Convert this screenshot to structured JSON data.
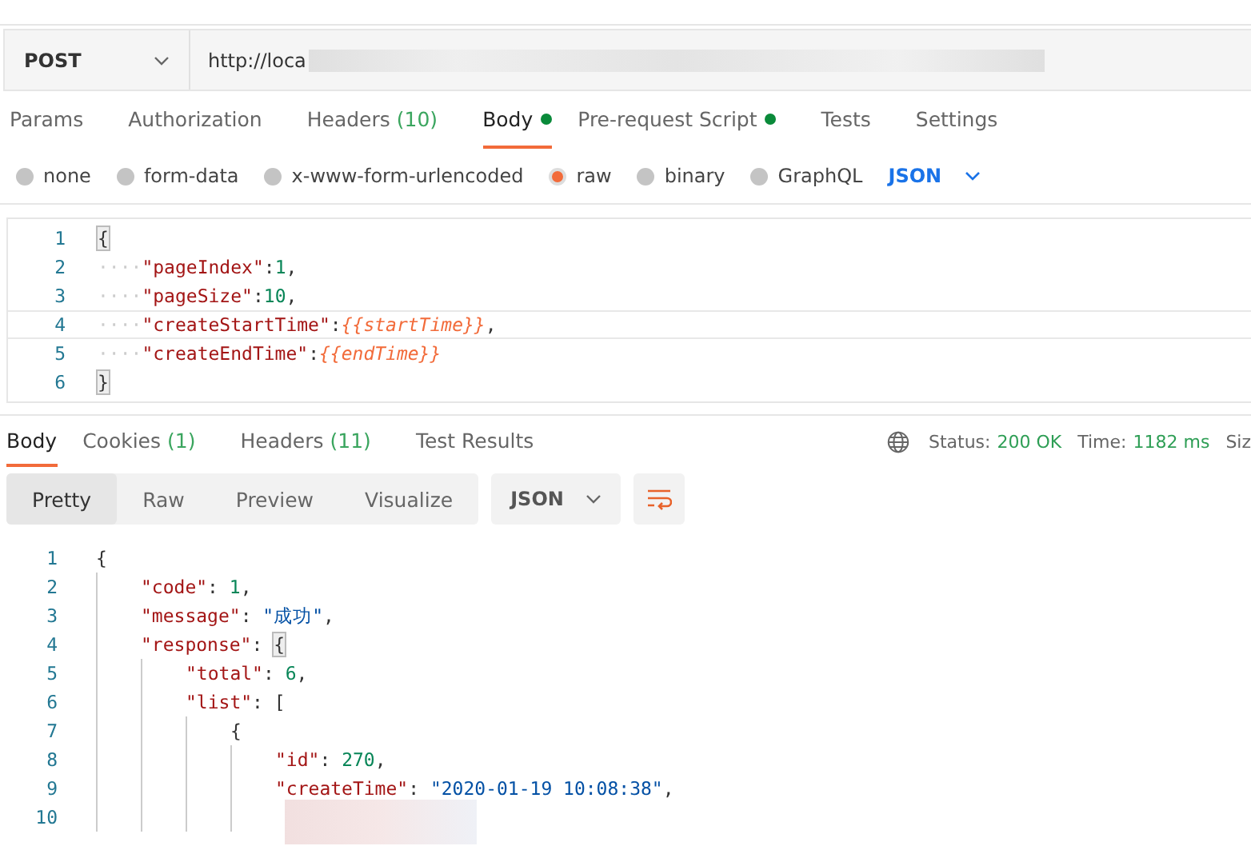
{
  "request": {
    "method": "POST",
    "url": "http://loca"
  },
  "request_tabs": [
    {
      "label": "Params",
      "selected": false
    },
    {
      "label": "Authorization",
      "selected": false
    },
    {
      "label": "Headers",
      "count": "(10)",
      "selected": false
    },
    {
      "label": "Body",
      "dot": true,
      "selected": true
    },
    {
      "label": "Pre-request Script",
      "dot": true,
      "selected": false
    },
    {
      "label": "Tests",
      "selected": false
    },
    {
      "label": "Settings",
      "selected": false
    }
  ],
  "body_types": [
    {
      "label": "none",
      "selected": false
    },
    {
      "label": "form-data",
      "selected": false
    },
    {
      "label": "x-www-form-urlencoded",
      "selected": false
    },
    {
      "label": "raw",
      "selected": true
    },
    {
      "label": "binary",
      "selected": false
    },
    {
      "label": "GraphQL",
      "selected": false
    }
  ],
  "body_format": "JSON",
  "request_body": [
    {
      "number": "1",
      "current": false,
      "tokens": [
        {
          "kind": "match",
          "text": "{"
        }
      ]
    },
    {
      "number": "2",
      "current": false,
      "tokens": [
        {
          "kind": "ws",
          "text": "····"
        },
        {
          "kind": "key",
          "text": "\"pageIndex\""
        },
        {
          "kind": "punct",
          "text": ":"
        },
        {
          "kind": "num",
          "text": "1"
        },
        {
          "kind": "punct",
          "text": ","
        }
      ]
    },
    {
      "number": "3",
      "current": false,
      "tokens": [
        {
          "kind": "ws",
          "text": "····"
        },
        {
          "kind": "key",
          "text": "\"pageSize\""
        },
        {
          "kind": "punct",
          "text": ":"
        },
        {
          "kind": "num",
          "text": "10"
        },
        {
          "kind": "punct",
          "text": ","
        }
      ]
    },
    {
      "number": "4",
      "current": true,
      "tokens": [
        {
          "kind": "ws",
          "text": "····"
        },
        {
          "kind": "key",
          "text": "\"createStartTime\""
        },
        {
          "kind": "punct",
          "text": ":"
        },
        {
          "kind": "var",
          "text": "{{startTime}}"
        },
        {
          "kind": "punct",
          "text": ","
        }
      ]
    },
    {
      "number": "5",
      "current": false,
      "tokens": [
        {
          "kind": "ws",
          "text": "····"
        },
        {
          "kind": "key",
          "text": "\"createEndTime\""
        },
        {
          "kind": "punct",
          "text": ":"
        },
        {
          "kind": "var",
          "text": "{{endTime}}"
        }
      ]
    },
    {
      "number": "6",
      "current": false,
      "tokens": [
        {
          "kind": "match",
          "text": "}"
        }
      ]
    }
  ],
  "response_tabs": [
    {
      "label": "Body",
      "selected": true
    },
    {
      "label": "Cookies",
      "count": "(1)",
      "selected": false
    },
    {
      "label": "Headers",
      "count": "(11)",
      "selected": false
    },
    {
      "label": "Test Results",
      "selected": false
    }
  ],
  "status": {
    "status_label": "Status:",
    "status_value": "200 OK",
    "time_label": "Time:",
    "time_value": "1182 ms",
    "size_label": "Siz"
  },
  "view_modes": [
    {
      "label": "Pretty",
      "selected": true
    },
    {
      "label": "Raw",
      "selected": false
    },
    {
      "label": "Preview",
      "selected": false
    },
    {
      "label": "Visualize",
      "selected": false
    }
  ],
  "response_format": "JSON",
  "response_body": [
    {
      "number": "1",
      "tokens": [
        {
          "kind": "open",
          "text": "{"
        }
      ]
    },
    {
      "number": "2",
      "tokens": [
        {
          "kind": "key",
          "text": "\"code\""
        },
        {
          "kind": "punct",
          "text": ": "
        },
        {
          "kind": "num",
          "text": "1"
        },
        {
          "kind": "punct",
          "text": ","
        }
      ]
    },
    {
      "number": "3",
      "tokens": [
        {
          "kind": "key",
          "text": "\"message\""
        },
        {
          "kind": "punct",
          "text": ": "
        },
        {
          "kind": "str",
          "text": "\"成功\""
        },
        {
          "kind": "punct",
          "text": ","
        }
      ]
    },
    {
      "number": "4",
      "tokens": [
        {
          "kind": "key",
          "text": "\"response\""
        },
        {
          "kind": "punct",
          "text": ": "
        },
        {
          "kind": "open-match",
          "text": "{"
        }
      ]
    },
    {
      "number": "5",
      "tokens": [
        {
          "kind": "key",
          "text": "\"total\""
        },
        {
          "kind": "punct",
          "text": ": "
        },
        {
          "kind": "num",
          "text": "6"
        },
        {
          "kind": "punct",
          "text": ","
        }
      ]
    },
    {
      "number": "6",
      "tokens": [
        {
          "kind": "key",
          "text": "\"list\""
        },
        {
          "kind": "punct",
          "text": ": "
        },
        {
          "kind": "open",
          "text": "["
        }
      ]
    },
    {
      "number": "7",
      "tokens": [
        {
          "kind": "open",
          "text": "{"
        }
      ]
    },
    {
      "number": "8",
      "tokens": [
        {
          "kind": "key",
          "text": "\"id\""
        },
        {
          "kind": "punct",
          "text": ": "
        },
        {
          "kind": "num",
          "text": "270"
        },
        {
          "kind": "punct",
          "text": ","
        }
      ]
    },
    {
      "number": "9",
      "tokens": [
        {
          "kind": "key",
          "text": "\"createTime\""
        },
        {
          "kind": "punct",
          "text": ": "
        },
        {
          "kind": "str",
          "text": "\"2020-01-19 10:08:38\""
        },
        {
          "kind": "punct",
          "text": ","
        }
      ]
    },
    {
      "number": "10"
    }
  ]
}
